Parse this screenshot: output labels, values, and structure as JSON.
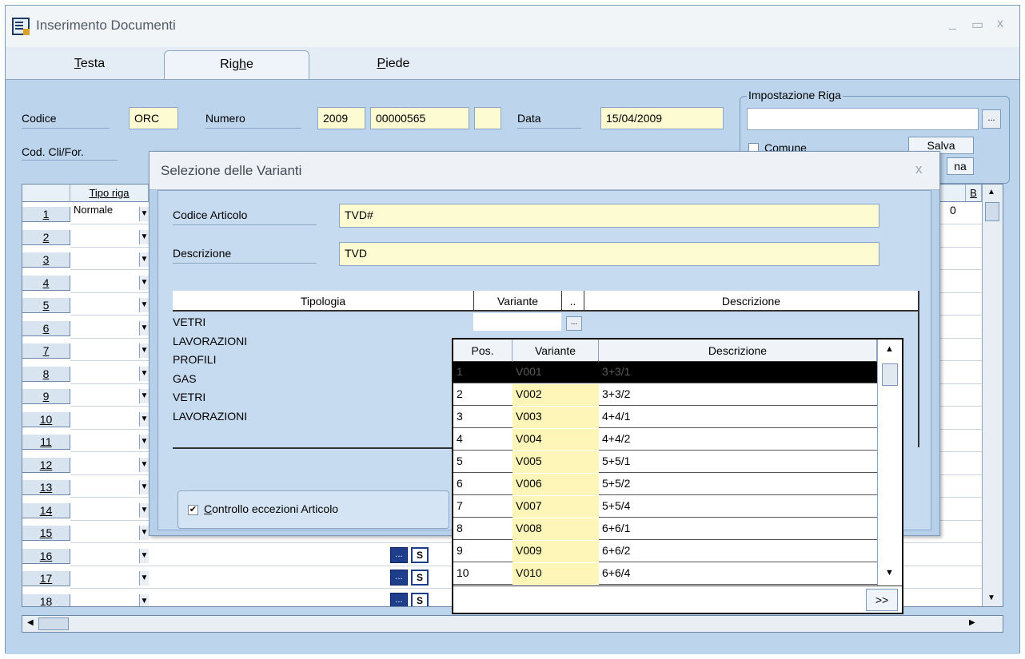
{
  "window": {
    "title": "Inserimento Documenti",
    "minimize": "_",
    "maximize": "▭",
    "close": "x"
  },
  "tabs": [
    {
      "pre": "",
      "ul": "T",
      "post": "esta"
    },
    {
      "pre": "Rig",
      "ul": "h",
      "post": "e"
    },
    {
      "pre": "",
      "ul": "P",
      "post": "iede"
    }
  ],
  "header": {
    "codice_label": "Codice",
    "codice_value": "ORC",
    "numero_label": "Numero",
    "anno_value": "2009",
    "numero_value": "00000565",
    "data_label": "Data",
    "data_value": "15/04/2009",
    "cliente_label": "Cod. Cli/For."
  },
  "impostazione": {
    "title": "Impostazione Riga",
    "comune_label": "Comune",
    "salva_label": "Salva",
    "second_button_label": "na",
    "browse_label": "..."
  },
  "grid": {
    "col_tipo": "Tipo riga",
    "col_right": "B",
    "row1_tipo": "Normale",
    "row1_right_value": "0",
    "rows": [
      "1",
      "2",
      "3",
      "4",
      "5",
      "6",
      "7",
      "8",
      "9",
      "10",
      "11",
      "12",
      "13",
      "14",
      "15",
      "16",
      "17",
      "18"
    ]
  },
  "dialog": {
    "title": "Selezione delle Varianti",
    "close": "x",
    "codice_label": "Codice Articolo",
    "codice_value": "TVD#",
    "descrizione_label": "Descrizione",
    "descrizione_value": "TVD",
    "col_tipologia": "Tipologia",
    "col_variante": "Variante",
    "col_dots": "..",
    "col_descrizione": "Descrizione",
    "tipologie": [
      "VETRI",
      "LAVORAZIONI",
      "PROFILI",
      "GAS",
      "VETRI",
      "LAVORAZIONI"
    ],
    "controllo_ul": "C",
    "controllo_rest": "ontrollo eccezioni Articolo",
    "controllo_checked": true
  },
  "popup": {
    "col_pos": "Pos.",
    "col_variante": "Variante",
    "col_descrizione": "Descrizione",
    "more_button": ">>",
    "rows": [
      {
        "pos": "1",
        "variante": "V001",
        "descrizione": "3+3/1"
      },
      {
        "pos": "2",
        "variante": "V002",
        "descrizione": "3+3/2"
      },
      {
        "pos": "3",
        "variante": "V003",
        "descrizione": "4+4/1"
      },
      {
        "pos": "4",
        "variante": "V004",
        "descrizione": "4+4/2"
      },
      {
        "pos": "5",
        "variante": "V005",
        "descrizione": "5+5/1"
      },
      {
        "pos": "6",
        "variante": "V006",
        "descrizione": "5+5/2"
      },
      {
        "pos": "7",
        "variante": "V007",
        "descrizione": "5+5/4"
      },
      {
        "pos": "8",
        "variante": "V008",
        "descrizione": "6+6/1"
      },
      {
        "pos": "9",
        "variante": "V009",
        "descrizione": "6+6/2"
      },
      {
        "pos": "10",
        "variante": "V010",
        "descrizione": "6+6/4"
      }
    ]
  },
  "colors": {
    "field_yellow": "#fdfbd2",
    "selected_row": "#000000",
    "dialog_blue": "#b7d0ea",
    "button_navy": "#1e3d8a"
  }
}
